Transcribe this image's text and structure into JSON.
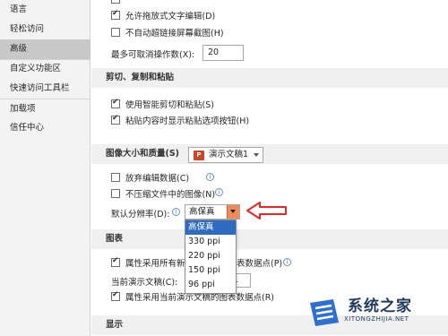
{
  "sidebar": {
    "items": [
      {
        "label": "语言"
      },
      {
        "label": "轻松访问"
      },
      {
        "label": "高级"
      },
      {
        "label": "自定义功能区"
      },
      {
        "label": "快速访问工具栏"
      },
      {
        "label": "加载项"
      },
      {
        "label": "信任中心"
      }
    ]
  },
  "editing": {
    "top_partial": "允许拖放式文字编辑(D)",
    "no_auto_link": "不自动超链接屏幕截图(H)",
    "max_undo_label": "最多可取消操作数(X):",
    "max_undo_value": "20"
  },
  "clipboard": {
    "heading": "剪切、复制和粘贴",
    "smart_cut": "使用智能剪切和粘贴(S)",
    "paste_options": "粘贴内容时显示粘贴选项按钮(H)"
  },
  "image": {
    "heading": "图像大小和质量(S)",
    "doc_icon": "P",
    "doc_name": "演示文稿1",
    "discard_edit": "放弃编辑数据(C)",
    "no_compress": "不压缩文件中的图像(N)",
    "default_res_label": "默认分辨率(D):",
    "default_res_value": "高保真",
    "options": [
      "高保真",
      "330 ppi",
      "220 ppi",
      "150 ppi",
      "96 ppi"
    ]
  },
  "chart": {
    "heading": "图表",
    "props_all_prefix": "属性采用所有新",
    "props_all_suffix": "表数据点(P)",
    "current_doc_label": "当前演示文稿(C):",
    "current_doc_value": "1",
    "props_current": "属性采用当前演示文稿的图表数据点(R)"
  },
  "display": {
    "heading": "显示"
  },
  "watermark": {
    "title": "系统之家",
    "url": "XITONGZHIJIA.NET"
  },
  "colors": {
    "selected": "#2e6cc2",
    "arrow": "#e8262a",
    "dropdown_button": "#f28a5a"
  }
}
